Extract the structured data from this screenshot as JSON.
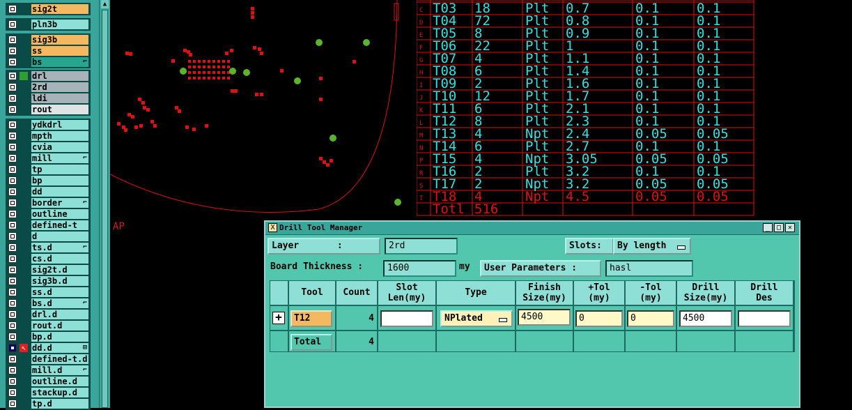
{
  "layers": [
    {
      "name": "sig2t",
      "style": "sig",
      "mark": ""
    },
    {
      "name": "pln3b",
      "style": "cyan",
      "mark": ""
    },
    {
      "name": "sig3b",
      "style": "sig",
      "mark": ""
    },
    {
      "name": "ss",
      "style": "sig",
      "mark": ""
    },
    {
      "name": "bs",
      "style": "green",
      "mark": "⌐"
    },
    {
      "name": "drl",
      "style": "gray",
      "mark": ""
    },
    {
      "name": "2rd",
      "style": "gray",
      "mark": ""
    },
    {
      "name": "ldi",
      "style": "gray",
      "mark": ""
    },
    {
      "name": "rout",
      "style": "light",
      "mark": ""
    },
    {
      "name": "ydkdrl",
      "style": "cyan",
      "mark": ""
    },
    {
      "name": "mpth",
      "style": "cyan",
      "mark": ""
    },
    {
      "name": "cvia",
      "style": "cyan",
      "mark": ""
    },
    {
      "name": "mill",
      "style": "cyan",
      "mark": "⌐"
    },
    {
      "name": "tp",
      "style": "cyan",
      "mark": ""
    },
    {
      "name": "bp",
      "style": "cyan",
      "mark": ""
    },
    {
      "name": "dd",
      "style": "cyan",
      "mark": ""
    },
    {
      "name": "border",
      "style": "cyan",
      "mark": "⌐"
    },
    {
      "name": "outline",
      "style": "cyan",
      "mark": ""
    },
    {
      "name": "defined-t",
      "style": "cyan",
      "mark": ""
    },
    {
      "name": "d",
      "style": "cyan",
      "mark": ""
    },
    {
      "name": "ts.d",
      "style": "cyan",
      "mark": "⌐"
    },
    {
      "name": "cs.d",
      "style": "cyan",
      "mark": ""
    },
    {
      "name": "sig2t.d",
      "style": "cyan",
      "mark": ""
    },
    {
      "name": "sig3b.d",
      "style": "cyan",
      "mark": ""
    },
    {
      "name": "ss.d",
      "style": "cyan",
      "mark": ""
    },
    {
      "name": "bs.d",
      "style": "cyan",
      "mark": "⌐"
    },
    {
      "name": "drl.d",
      "style": "cyan",
      "mark": ""
    },
    {
      "name": "rout.d",
      "style": "cyan",
      "mark": ""
    },
    {
      "name": "bp.d",
      "style": "cyan",
      "mark": ""
    },
    {
      "name": "dd.d",
      "style": "cyan",
      "mark": "⊞"
    },
    {
      "name": "defined-t.d",
      "style": "cyan",
      "mark": ""
    },
    {
      "name": "mill.d",
      "style": "cyan",
      "mark": "⌐"
    },
    {
      "name": "outline.d",
      "style": "cyan",
      "mark": ""
    },
    {
      "name": "stackup.d",
      "style": "cyan",
      "mark": ""
    },
    {
      "name": "tp.d",
      "style": "cyan",
      "mark": ""
    }
  ],
  "canvas": {
    "ap_label": "AP"
  },
  "report_rows": [
    {
      "letter": "C",
      "tool": "T03",
      "count": "18",
      "type": "Plt",
      "size": "0.7",
      "ptol": "0.1",
      "mtol": "0.1"
    },
    {
      "letter": "D",
      "tool": "T04",
      "count": "72",
      "type": "Plt",
      "size": "0.8",
      "ptol": "0.1",
      "mtol": "0.1"
    },
    {
      "letter": "E",
      "tool": "T05",
      "count": "8",
      "type": "Plt",
      "size": "0.9",
      "ptol": "0.1",
      "mtol": "0.1"
    },
    {
      "letter": "F",
      "tool": "T06",
      "count": "22",
      "type": "Plt",
      "size": "1",
      "ptol": "0.1",
      "mtol": "0.1"
    },
    {
      "letter": "G",
      "tool": "T07",
      "count": "4",
      "type": "Plt",
      "size": "1.1",
      "ptol": "0.1",
      "mtol": "0.1"
    },
    {
      "letter": "H",
      "tool": "T08",
      "count": "6",
      "type": "Plt",
      "size": "1.4",
      "ptol": "0.1",
      "mtol": "0.1"
    },
    {
      "letter": "I",
      "tool": "T09",
      "count": "2",
      "type": "Plt",
      "size": "1.6",
      "ptol": "0.1",
      "mtol": "0.1"
    },
    {
      "letter": "J",
      "tool": "T10",
      "count": "12",
      "type": "Plt",
      "size": "1.7",
      "ptol": "0.1",
      "mtol": "0.1"
    },
    {
      "letter": "K",
      "tool": "T11",
      "count": "6",
      "type": "Plt",
      "size": "2.1",
      "ptol": "0.1",
      "mtol": "0.1"
    },
    {
      "letter": "L",
      "tool": "T12",
      "count": "8",
      "type": "Plt",
      "size": "2.3",
      "ptol": "0.1",
      "mtol": "0.1"
    },
    {
      "letter": "M",
      "tool": "T13",
      "count": "4",
      "type": "Npt",
      "size": "2.4",
      "ptol": "0.05",
      "mtol": "0.05"
    },
    {
      "letter": "N",
      "tool": "T14",
      "count": "6",
      "type": "Plt",
      "size": "2.7",
      "ptol": "0.1",
      "mtol": "0.1"
    },
    {
      "letter": "P",
      "tool": "T15",
      "count": "4",
      "type": "Npt",
      "size": "3.05",
      "ptol": "0.05",
      "mtol": "0.05"
    },
    {
      "letter": "R",
      "tool": "T16",
      "count": "2",
      "type": "Plt",
      "size": "3.2",
      "ptol": "0.1",
      "mtol": "0.1"
    },
    {
      "letter": "S",
      "tool": "T17",
      "count": "2",
      "type": "Npt",
      "size": "3.2",
      "ptol": "0.05",
      "mtol": "0.05"
    },
    {
      "letter": "T",
      "tool": "T18",
      "count": "4",
      "type": "Npt",
      "size": "4.5",
      "ptol": "0.05",
      "mtol": "0.05",
      "highlight": true
    }
  ],
  "report_total": {
    "label": "Totl",
    "count": "516"
  },
  "dialog": {
    "title": "Drill Tool Manager",
    "icon": "X",
    "layer_label": "Layer       :",
    "layer_value": "2rd",
    "slots_label": "Slots:",
    "slots_value": "By length",
    "thickness_label": "Board Thickness :",
    "thickness_value": "1600",
    "thickness_unit": "my",
    "user_params_label": "User Parameters :",
    "user_params_value": "hasl",
    "columns": {
      "tool": "Tool",
      "count": "Count",
      "slot1": "Slot",
      "slot2": "Len(my)",
      "type": "Type",
      "finish1": "Finish",
      "finish2": "Size(my)",
      "ptol1": "+Tol",
      "ptol2": "(my)",
      "mtol1": "-Tol",
      "mtol2": "(my)",
      "drill1": "Drill",
      "drill2": "Size(my)",
      "des1": "Drill",
      "des2": "Des"
    },
    "row": {
      "expand": "+",
      "tool": "T12",
      "count": "4",
      "slot_len": "",
      "type": "NPlated",
      "finish": "4500",
      "ptol": "0",
      "mtol": "0",
      "drill": "4500",
      "des": ""
    },
    "total": {
      "label": "Total",
      "count": "4"
    }
  },
  "colors": {
    "accent": "#52c7ad",
    "report_text": "#33e0e0",
    "report_grid": "#e01010",
    "tool_highlight": "#f4b860"
  }
}
